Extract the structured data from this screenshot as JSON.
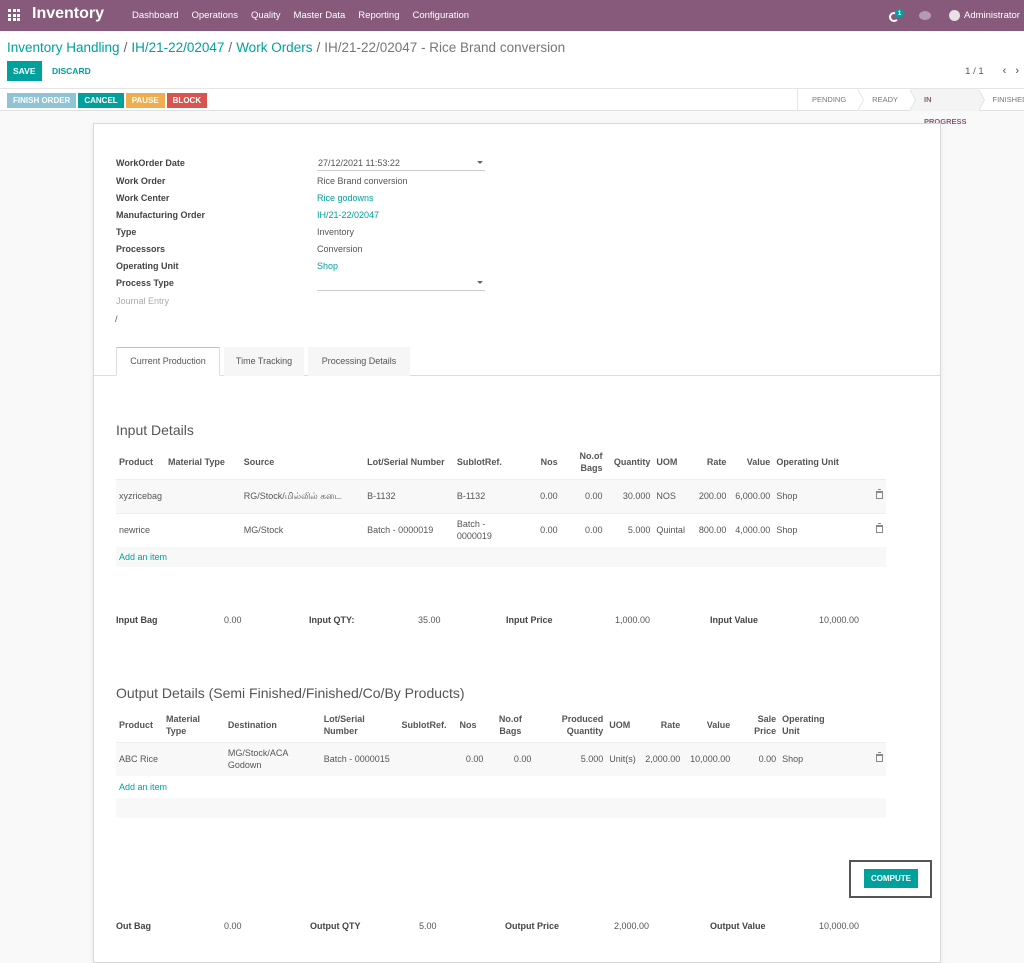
{
  "navbar": {
    "app_name": "Inventory",
    "menu": [
      "Dashboard",
      "Operations",
      "Quality",
      "Master Data",
      "Reporting",
      "Configuration"
    ],
    "activity_count": "1",
    "user": "Administrator"
  },
  "breadcrumb": {
    "items": [
      "Inventory Handling",
      "IH/21-22/02047",
      "Work Orders"
    ],
    "current": "IH/21-22/02047 - Rice Brand conversion"
  },
  "toolbar": {
    "save_label": "SAVE",
    "discard_label": "DISCARD",
    "pager_counter": "1 / 1",
    "prev_icon": "‹",
    "next_icon": "›"
  },
  "header_buttons": {
    "finish": "FINISH ORDER",
    "cancel": "CANCEL",
    "pause": "PAUSE",
    "block": "BLOCK"
  },
  "statusbar": {
    "stages": [
      "PENDING",
      "READY",
      "IN PROGRESS",
      "FINISHED"
    ],
    "active": "IN PROGRESS"
  },
  "form": {
    "fields": {
      "workorder_date": {
        "label": "WorkOrder Date",
        "value": "27/12/2021 11:53:22"
      },
      "work_order": {
        "label": "Work Order",
        "value": "Rice Brand conversion"
      },
      "work_center": {
        "label": "Work Center",
        "value": "Rice godowns"
      },
      "manufacturing_order": {
        "label": "Manufacturing Order",
        "value": "IH/21-22/02047"
      },
      "type": {
        "label": "Type",
        "value": "Inventory"
      },
      "processors": {
        "label": "Processors",
        "value": "Conversion"
      },
      "operating_unit": {
        "label": "Operating Unit",
        "value": "Shop"
      },
      "process_type": {
        "label": "Process Type",
        "value": ""
      },
      "journal_entry": {
        "label": "Journal Entry",
        "value": "/"
      }
    },
    "tabs": [
      "Current Production",
      "Time Tracking",
      "Processing Details"
    ],
    "active_tab": "Current Production"
  },
  "input_details": {
    "title": "Input Details",
    "headers": [
      "Product",
      "Material Type",
      "Source",
      "Lot/Serial Number",
      "SublotRef.",
      "Nos",
      "No.of Bags",
      "Quantity",
      "UOM",
      "Rate",
      "Value",
      "Operating Unit"
    ],
    "rows": [
      {
        "product": "xyzricebag",
        "material_type": "",
        "source": "RG/Stock/மில்லில் கடை",
        "lot": "B-1132",
        "sublot": "B-1132",
        "nos": "0.00",
        "bags": "0.00",
        "quantity": "30.000",
        "uom": "NOS",
        "rate": "200.00",
        "value": "6,000.00",
        "unit": "Shop"
      },
      {
        "product": "newrice",
        "material_type": "",
        "source": "MG/Stock",
        "lot": "Batch - 0000019",
        "sublot": "Batch - 0000019",
        "nos": "0.00",
        "bags": "0.00",
        "quantity": "5.000",
        "uom": "Quintal",
        "rate": "800.00",
        "value": "4,000.00",
        "unit": "Shop"
      }
    ],
    "add_label": "Add an item"
  },
  "input_summary": {
    "bag_label": "Input Bag",
    "bag_value": "0.00",
    "qty_label": "Input QTY:",
    "qty_value": "35.00",
    "price_label": "Input Price",
    "price_value": "1,000.00",
    "value_label": "Input Value",
    "value_value": "10,000.00"
  },
  "output_details": {
    "title": "Output Details (Semi Finished/Finished/Co/By Products)",
    "headers": [
      "Product",
      "Material Type",
      "Destination",
      "Lot/Serial Number",
      "SublotRef.",
      "Nos",
      "No.of Bags",
      "Produced Quantity",
      "UOM",
      "Rate",
      "Value",
      "Sale Price",
      "Operating Unit"
    ],
    "rows": [
      {
        "product": "ABC Rice",
        "material_type": "",
        "destination": "MG/Stock/ACA Godown",
        "lot": "Batch - 0000015",
        "sublot": "",
        "nos": "0.00",
        "bags": "0.00",
        "quantity": "5.000",
        "uom": "Unit(s)",
        "rate": "2,000.00",
        "value": "10,000.00",
        "sale_price": "0.00",
        "unit": "Shop"
      }
    ],
    "add_label": "Add an item"
  },
  "compute_label": "COMPUTE",
  "output_summary": {
    "bag_label": "Out Bag",
    "bag_value": "0.00",
    "qty_label": "Output QTY",
    "qty_value": "5.00",
    "price_label": "Output Price",
    "price_value": "2,000.00",
    "value_label": "Output Value",
    "value_value": "10,000.00"
  },
  "colors": {
    "navbar": "#875a7b",
    "primary": "#00a09d",
    "finish_btn": "#8fc3d6",
    "pause_btn": "#f0ad4e",
    "block_btn": "#d9534f"
  }
}
